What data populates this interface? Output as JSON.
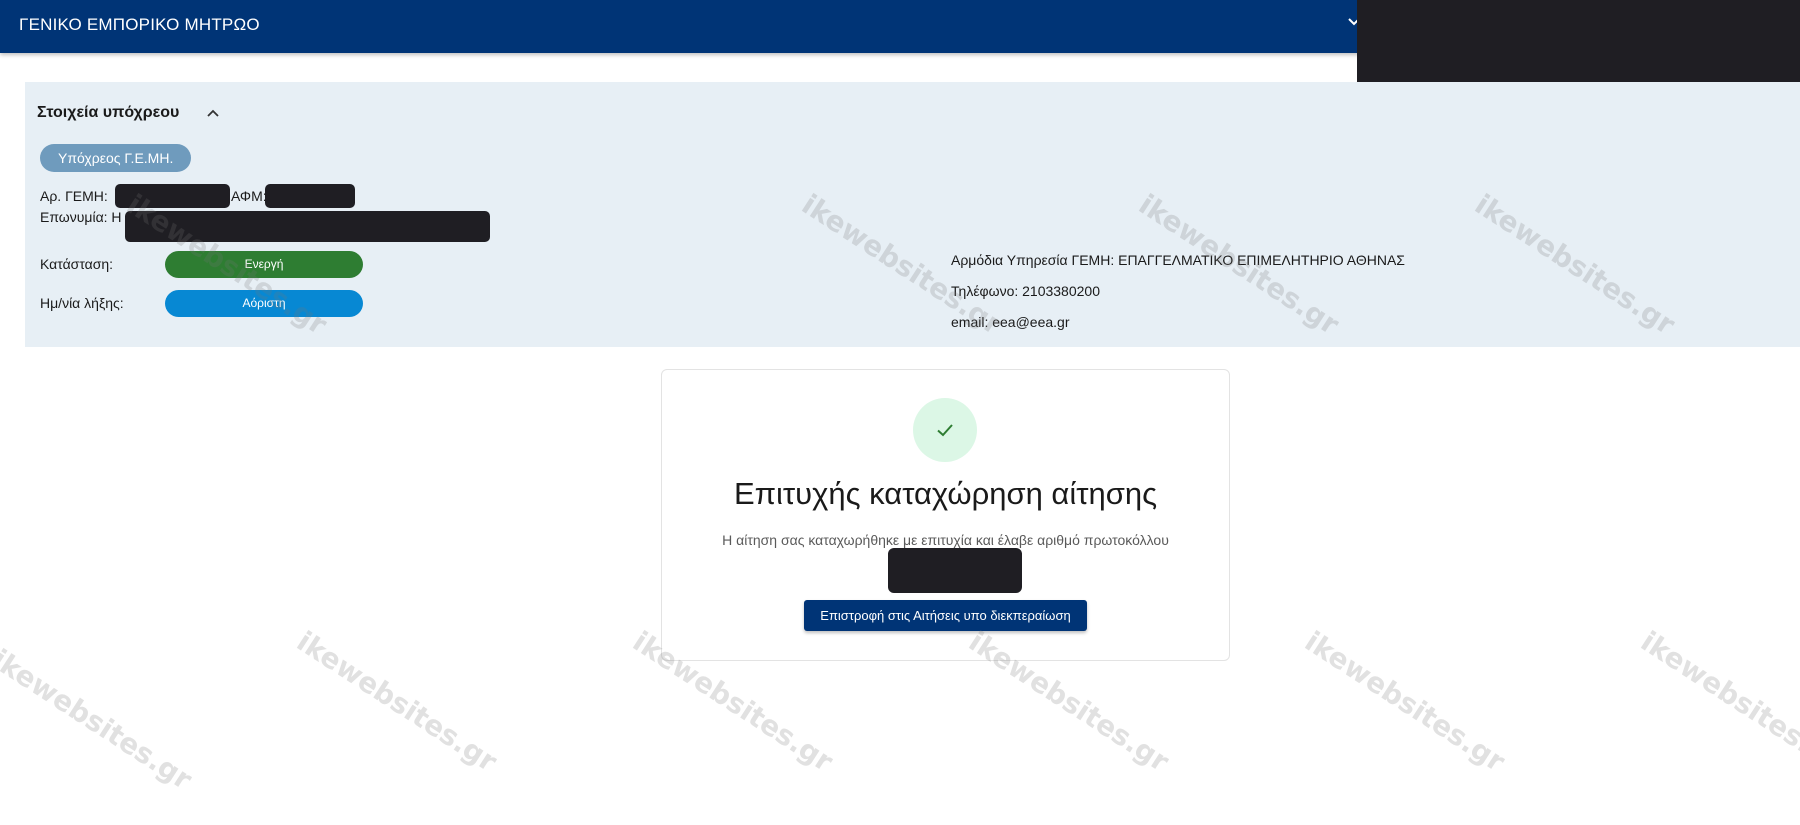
{
  "header": {
    "title": "ΓΕΝΙΚΟ ΕΜΠΟΡΙΚΟ ΜΗΤΡΩΟ"
  },
  "obligee": {
    "section_title": "Στοιχεία υπόχρεου",
    "role_chip": "Υπόχρεος Γ.Ε.ΜΗ.",
    "gemi_label": "Αρ. ΓΕΜΗ:",
    "afm_label": "ΑΦΜ: 8",
    "eponymia_label": "Επωνυμία: Η",
    "status_label": "Κατάσταση:",
    "status_value": "Ενεργή",
    "end_date_label": "Ημ/νία λήξης:",
    "end_date_value": "Αόριστη",
    "authority": "Αρμόδια Υπηρεσία ΓΕΜΗ: ΕΠΑΓΓΕΛΜΑΤΙΚΟ ΕΠΙΜΕΛΗΤΗΡΙΟ ΑΘΗΝΑΣ",
    "phone": "Τηλέφωνο: 2103380200",
    "email": "email: eea@eea.gr"
  },
  "success": {
    "icon": "check-icon",
    "title": "Επιτυχής καταχώρηση αίτησης",
    "message": "Η αίτηση σας καταχωρήθηκε με επιτυχία και έλαβε αριθμό πρωτοκόλλου",
    "button_label": "Επιστροφή στις Αιτήσεις υπο διεκπεραίωση"
  },
  "watermark": "ikewebsites.gr",
  "colors": {
    "header_bg": "#003476",
    "panel_bg": "#e7eff5",
    "status_active": "#2e7d32",
    "end_date": "#0788d3",
    "role_chip": "#6f9bbd",
    "success_circle": "#dcf7e6",
    "success_check": "#2e7d32"
  }
}
